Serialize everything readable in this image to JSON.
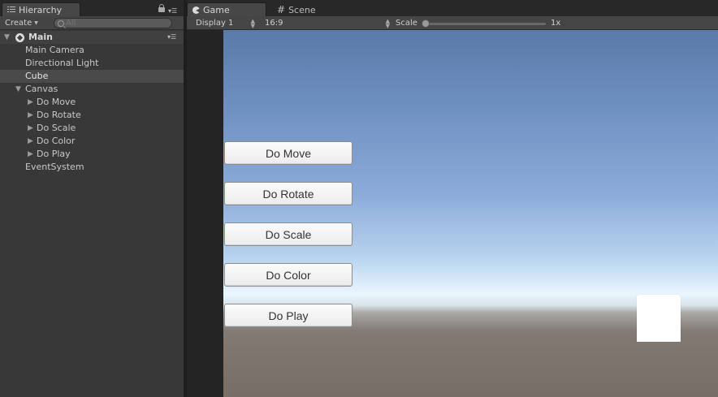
{
  "hierarchy": {
    "tab_label": "Hierarchy",
    "tab_icon": "hierarchy-lines-icon",
    "create_label": "Create",
    "search_placeholder": "All",
    "scene_name": "Main",
    "items": [
      {
        "label": "Main Camera"
      },
      {
        "label": "Directional Light"
      },
      {
        "label": "Cube",
        "selected": true
      },
      {
        "label": "Canvas"
      },
      {
        "label": "Do Move"
      },
      {
        "label": "Do Rotate"
      },
      {
        "label": "Do Scale"
      },
      {
        "label": "Do Color"
      },
      {
        "label": "Do Play"
      },
      {
        "label": "EventSystem"
      }
    ]
  },
  "game": {
    "tabs": [
      {
        "label": "Game",
        "icon": "pacman-icon",
        "active": true
      },
      {
        "label": "Scene",
        "icon": "grid-icon",
        "active": false
      }
    ],
    "toolbar": {
      "display": "Display 1",
      "aspect": "16:9",
      "scale_label": "Scale",
      "scale_value": "1x",
      "scale_fraction": 0.0
    },
    "buttons": [
      {
        "label": "Do Move"
      },
      {
        "label": "Do Rotate"
      },
      {
        "label": "Do Scale"
      },
      {
        "label": "Do Color"
      },
      {
        "label": "Do Play"
      }
    ]
  },
  "colors": {
    "panel_bg": "#383838",
    "selected_row": "#4a4a4a",
    "button_bg": "#f5f5f5",
    "cube": "#ffffff"
  }
}
